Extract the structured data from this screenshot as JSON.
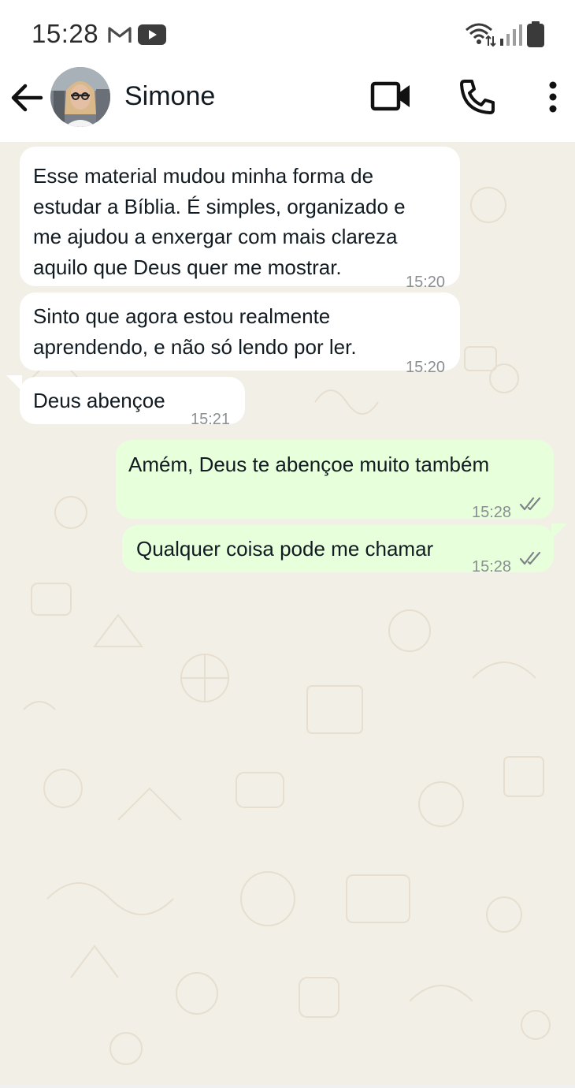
{
  "status_bar": {
    "time": "15:28",
    "icons": [
      "gmail-icon",
      "youtube-icon",
      "wifi-icon",
      "signal-icon",
      "battery-icon"
    ]
  },
  "header": {
    "contact_name": "Simone",
    "icons": [
      "back-arrow-icon",
      "avatar",
      "video-call-icon",
      "voice-call-icon",
      "more-options-icon"
    ]
  },
  "colors": {
    "incoming_bubble": "#ffffff",
    "outgoing_bubble": "#e7ffdb",
    "chat_background": "#f2efe7",
    "timestamp": "#8a8f92"
  },
  "messages": [
    {
      "direction": "incoming",
      "text": "Esse material mudou minha forma de\nestudar a Bíblia. É simples, organizado e\nme ajudou a enxergar com mais clareza\naquilo que Deus quer me mostrar.",
      "time": "15:20"
    },
    {
      "direction": "incoming",
      "text": "Sinto que agora estou realmente\naprendendo, e não só lendo por ler.",
      "time": "15:20"
    },
    {
      "direction": "incoming",
      "text": "Deus abençoe",
      "time": "15:21"
    },
    {
      "direction": "outgoing",
      "text": "Amém, Deus te abençoe muito também",
      "time": "15:28",
      "status": "read"
    },
    {
      "direction": "outgoing",
      "text": "Qualquer coisa pode me chamar",
      "time": "15:28",
      "status": "read"
    }
  ]
}
